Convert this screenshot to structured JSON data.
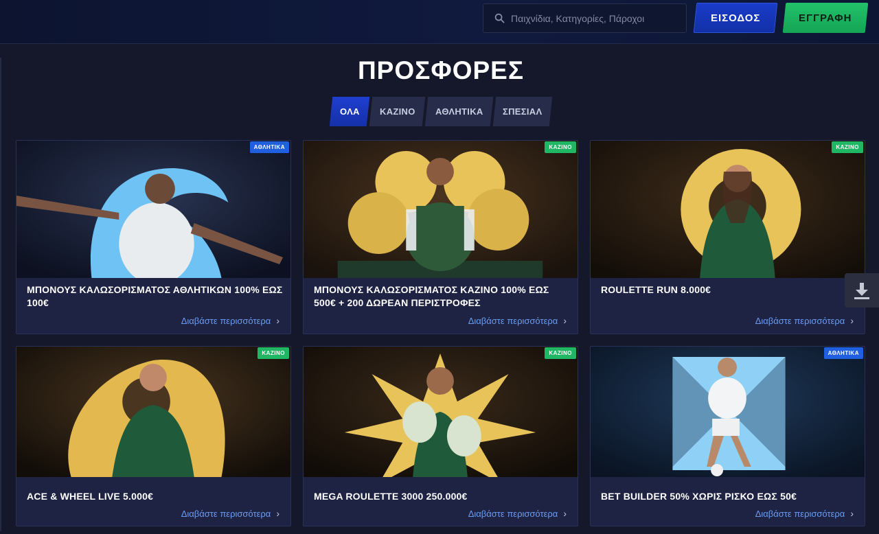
{
  "header": {
    "search_placeholder": "Παιχνίδια, Κατηγορίες, Πάροχοι",
    "login_label": "ΕΙΣΟΔΟΣ",
    "register_label": "ΕΓΓΡΑΦΗ"
  },
  "page": {
    "title": "ΠΡΟΣΦΟΡΕΣ",
    "tabs": [
      "ΟΛΑ",
      "ΚΑΖΙΝΟ",
      "ΑΘΛΗΤΙΚΑ",
      "ΣΠΕΣΙΑΛ"
    ],
    "active_tab": "ΟΛΑ"
  },
  "promotions": [
    {
      "badge": "ΑΘΛΗΤΙΚΑ",
      "title": "ΜΠΟΝΟΥΣ ΚΑΛΩΣΟΡΙΣΜΑΤΟΣ ΑΘΛΗΤΙΚΩΝ 100% ΕΩΣ 100€",
      "more": "Διαβάστε περισσότερα"
    },
    {
      "badge": "ΚΑΖΙΝΟ",
      "title": "ΜΠΟΝΟΥΣ ΚΑΛΩΣΟΡΙΣΜΑΤΟΣ ΚΑΖΙΝΟ 100% ΕΩΣ 500€ + 200 ΔΩΡΕΑΝ ΠΕΡΙΣΤΡΟΦΕΣ",
      "more": "Διαβάστε περισσότερα"
    },
    {
      "badge": "ΚΑΖΙΝΟ",
      "title": "ROULETTE RUN 8.000€",
      "more": "Διαβάστε περισσότερα"
    },
    {
      "badge": "ΚΑΖΙΝΟ",
      "title": "ACE & WHEEL LIVE 5.000€",
      "more": "Διαβάστε περισσότερα"
    },
    {
      "badge": "ΚΑΖΙΝΟ",
      "title": "MEGA ROULETTE 3000 250.000€",
      "more": "Διαβάστε περισσότερα"
    },
    {
      "badge": "ΑΘΛΗΤΙΚΑ",
      "title": "BET BUILDER 50% ΧΩΡΙΣ ΡΙΣΚΟ ΕΩΣ 50€",
      "more": "Διαβάστε περισσότερα"
    }
  ],
  "colors": {
    "background": "#15172a",
    "accent_blue": "#1f3fd0",
    "accent_green": "#22c16a",
    "link": "#6a9cf2"
  },
  "icons": {
    "search": "search-icon",
    "chevron": "chevron-right-icon",
    "download": "download-icon"
  }
}
